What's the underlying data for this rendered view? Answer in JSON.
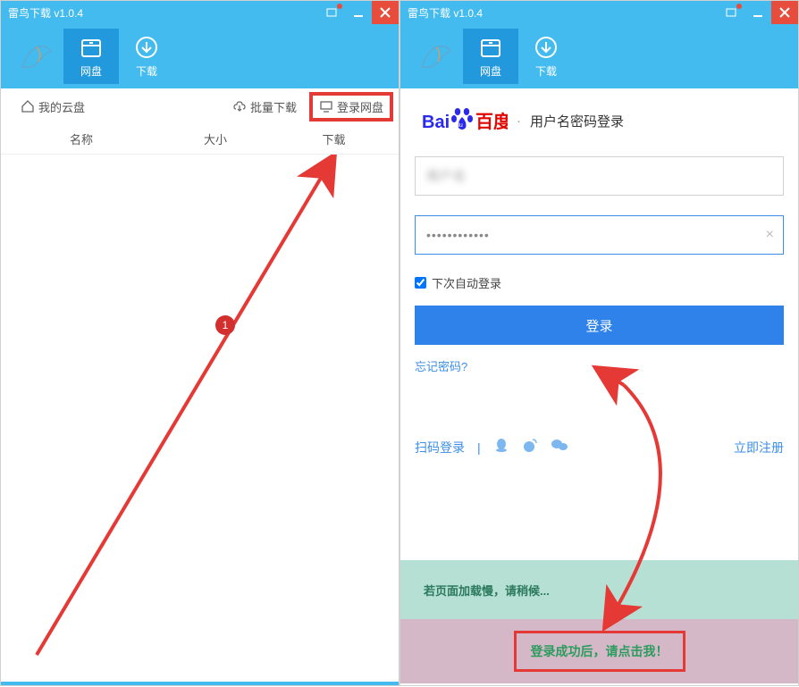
{
  "titlebar": {
    "title": "雷鸟下载 v1.0.4"
  },
  "tabs": {
    "pan": "网盘",
    "download": "下载"
  },
  "content_bar": {
    "my_cloud": "我的云盘",
    "batch_download": "批量下载",
    "login_pan": "登录网盘"
  },
  "columns": {
    "name": "名称",
    "size": "大小",
    "download": "下载"
  },
  "annotation": {
    "step1": "1"
  },
  "brand": {
    "bai": "Bai",
    "du": "du",
    "baidu_cn": "百度",
    "sep": "·",
    "login_title": "用户名密码登录"
  },
  "login": {
    "username_masked": "用户名",
    "password_value": "••••••••••••",
    "auto_login": "下次自动登录",
    "submit": "登录",
    "forgot": "忘记密码?"
  },
  "alt": {
    "qr_login": "扫码登录",
    "sep": "|",
    "register": "立即注册"
  },
  "notes": {
    "slow": "若页面加载慢，请稍候...",
    "success": "登录成功后，请点击我！"
  }
}
